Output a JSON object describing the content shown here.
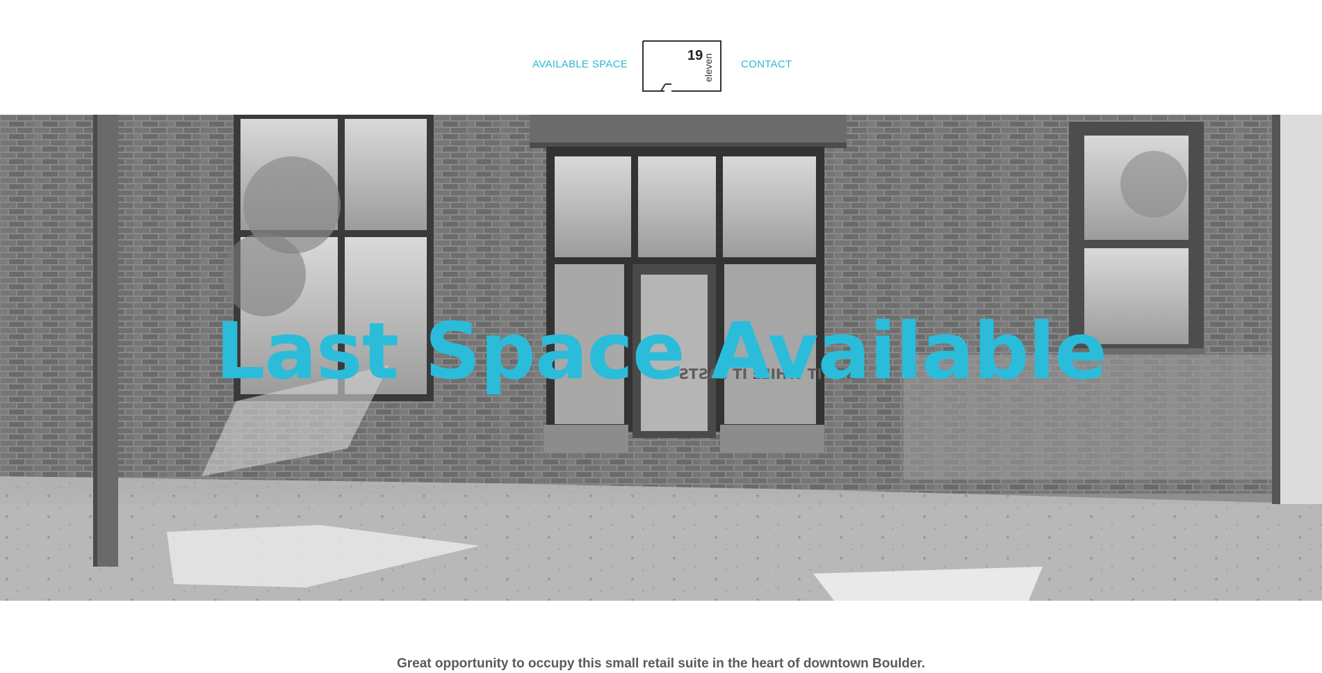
{
  "nav": {
    "left_link": "AVAILABLE SPACE",
    "right_link": "CONTACT"
  },
  "logo": {
    "number": "19",
    "word": "eleven"
  },
  "hero": {
    "title": "Last Space Available",
    "photo_sign_text": "GET IT WHILE IT LASTS"
  },
  "intro": {
    "text": "Great opportunity to occupy this small retail suite in the heart of downtown Boulder."
  },
  "colors": {
    "accent": "#2bb8d4",
    "body_text": "#5a5a5a"
  }
}
